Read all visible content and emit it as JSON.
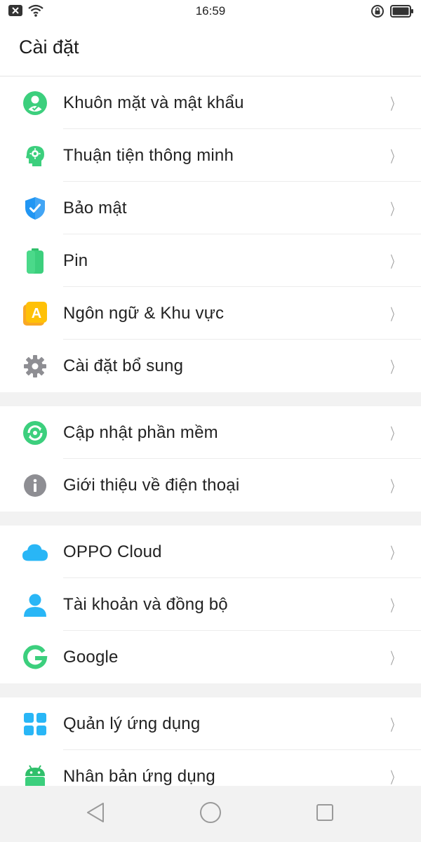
{
  "status": {
    "time": "16:59",
    "left_icons": [
      "notification-close-icon",
      "wifi-icon"
    ],
    "right_icons": [
      "rotation-lock-icon",
      "battery-icon"
    ]
  },
  "header": {
    "title": "Cài đặt"
  },
  "groups": [
    {
      "items": [
        {
          "label": "Khuôn mặt và mật khẩu",
          "icon": "face-password-icon",
          "color": "#3ccf7d"
        },
        {
          "label": "Thuận tiện thông minh",
          "icon": "smart-convenience-icon",
          "color": "#3ccf7d"
        },
        {
          "label": "Bảo mật",
          "icon": "security-shield-icon",
          "color": "#2196f3"
        },
        {
          "label": "Pin",
          "icon": "battery-icon",
          "color": "#3ccf7d"
        },
        {
          "label": "Ngôn ngữ & Khu vực",
          "icon": "language-icon",
          "color": "#f9a825"
        },
        {
          "label": "Cài đặt bổ sung",
          "icon": "gear-icon",
          "color": "#8e8e93"
        }
      ]
    },
    {
      "items": [
        {
          "label": "Cập nhật phần mềm",
          "icon": "software-update-icon",
          "color": "#3ccf7d"
        },
        {
          "label": "Giới thiệu về điện thoại",
          "icon": "info-icon",
          "color": "#8e8e93"
        }
      ]
    },
    {
      "items": [
        {
          "label": "OPPO Cloud",
          "icon": "cloud-icon",
          "color": "#29b6f6"
        },
        {
          "label": "Tài khoản và đồng bộ",
          "icon": "account-icon",
          "color": "#29b6f6"
        },
        {
          "label": "Google",
          "icon": "google-icon",
          "color": "#3ccf7d"
        }
      ]
    },
    {
      "items": [
        {
          "label": "Quản lý ứng dụng",
          "icon": "app-management-icon",
          "color": "#29b6f6"
        },
        {
          "label": "Nhân bản ứng dụng",
          "icon": "app-clone-icon",
          "color": "#3ccf7d"
        }
      ]
    }
  ],
  "nav": {
    "buttons": [
      "back-icon",
      "home-icon",
      "recents-icon"
    ]
  }
}
